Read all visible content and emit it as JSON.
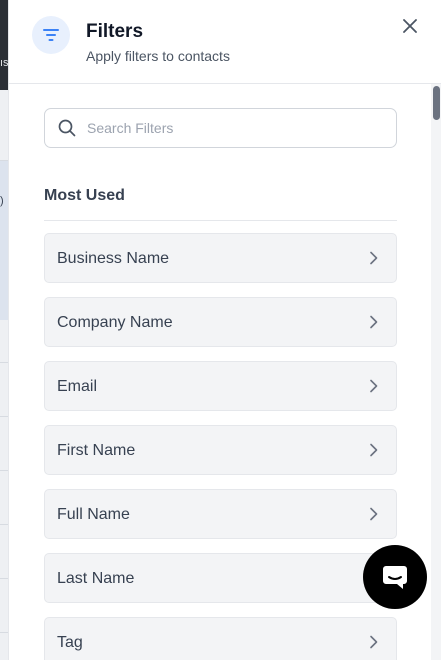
{
  "background": {
    "fragment_top": "ıs",
    "fragment_mid": ")"
  },
  "header": {
    "title": "Filters",
    "subtitle": "Apply filters to contacts",
    "icon": "filter-icon",
    "close_icon": "close-icon"
  },
  "search": {
    "placeholder": "Search Filters",
    "value": "",
    "icon": "search-icon"
  },
  "section": {
    "title": "Most Used"
  },
  "filters": [
    {
      "label": "Business Name"
    },
    {
      "label": "Company Name"
    },
    {
      "label": "Email"
    },
    {
      "label": "First Name"
    },
    {
      "label": "Full Name"
    },
    {
      "label": "Last Name"
    },
    {
      "label": "Tag"
    }
  ],
  "chat": {
    "icon": "chat-icon"
  },
  "colors": {
    "accent": "#3b82f6",
    "icon_bg": "#e8f0fd",
    "item_bg": "#f3f4f6",
    "chat_bg": "#000000"
  }
}
